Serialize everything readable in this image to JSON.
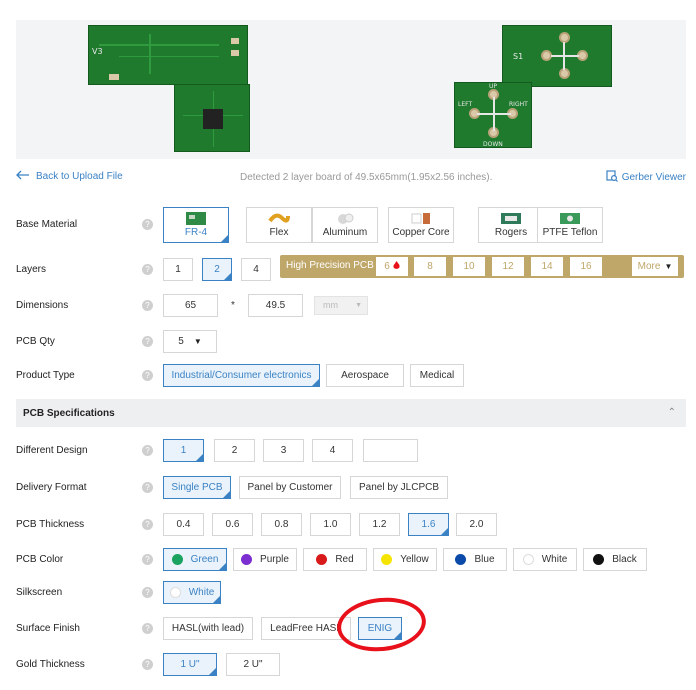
{
  "preview": {
    "left_text": "V3",
    "right_labels": [
      "UP",
      "LEFT",
      "RIGHT",
      "DOWN",
      "S1"
    ]
  },
  "topbar": {
    "back_label": "Back to Upload File",
    "detected_text": "Detected 2 layer board of 49.5x65mm(1.95x2.56 inches).",
    "gerber_label": "Gerber Viewer"
  },
  "help_glyph": "?",
  "base_material": {
    "label": "Base Material",
    "options": [
      "FR-4",
      "Flex",
      "Aluminum",
      "Copper Core",
      "Rogers",
      "PTFE Teflon"
    ],
    "selected": "FR-4"
  },
  "layers": {
    "label": "Layers",
    "options": [
      "1",
      "2",
      "4"
    ],
    "selected": "2",
    "high_precision_title": "High Precision PCB",
    "high_precision_options": [
      "6",
      "8",
      "10",
      "12",
      "14",
      "16"
    ],
    "more_label": "More"
  },
  "dimensions": {
    "label": "Dimensions",
    "width": "65",
    "separator": "*",
    "height": "49.5",
    "unit": "mm"
  },
  "pcb_qty": {
    "label": "PCB Qty",
    "value": "5"
  },
  "product_type": {
    "label": "Product Type",
    "options": [
      "Industrial/Consumer electronics",
      "Aerospace",
      "Medical"
    ],
    "selected": "Industrial/Consumer electronics"
  },
  "pcb_specifications": {
    "title": "PCB Specifications"
  },
  "different_design": {
    "label": "Different Design",
    "options": [
      "1",
      "2",
      "3",
      "4",
      ""
    ],
    "selected": "1"
  },
  "delivery_format": {
    "label": "Delivery Format",
    "options": [
      "Single PCB",
      "Panel by Customer",
      "Panel by JLCPCB"
    ],
    "selected": "Single PCB"
  },
  "pcb_thickness": {
    "label": "PCB Thickness",
    "options": [
      "0.4",
      "0.6",
      "0.8",
      "1.0",
      "1.2",
      "1.6",
      "2.0"
    ],
    "selected": "1.6"
  },
  "pcb_color": {
    "label": "PCB Color",
    "options": [
      {
        "name": "Green",
        "color": "#1aa260"
      },
      {
        "name": "Purple",
        "color": "#7b2fd0"
      },
      {
        "name": "Red",
        "color": "#d91a1a"
      },
      {
        "name": "Yellow",
        "color": "#f5e400"
      },
      {
        "name": "Blue",
        "color": "#0b4aa8"
      },
      {
        "name": "White",
        "color": "#ffffff"
      },
      {
        "name": "Black",
        "color": "#111111"
      }
    ],
    "selected": "Green"
  },
  "silkscreen": {
    "label": "Silkscreen",
    "value": "White"
  },
  "surface_finish": {
    "label": "Surface Finish",
    "options": [
      "HASL(with lead)",
      "LeadFree HASL",
      "ENIG"
    ],
    "selected": "ENIG"
  },
  "gold_thickness": {
    "label": "Gold Thickness",
    "options": [
      "1 U\"",
      "2 U\""
    ],
    "selected": "1 U\""
  },
  "colors": {
    "accent": "#3b82c4",
    "high_precision": "#bfa76a",
    "annotation": "#e8101a"
  }
}
